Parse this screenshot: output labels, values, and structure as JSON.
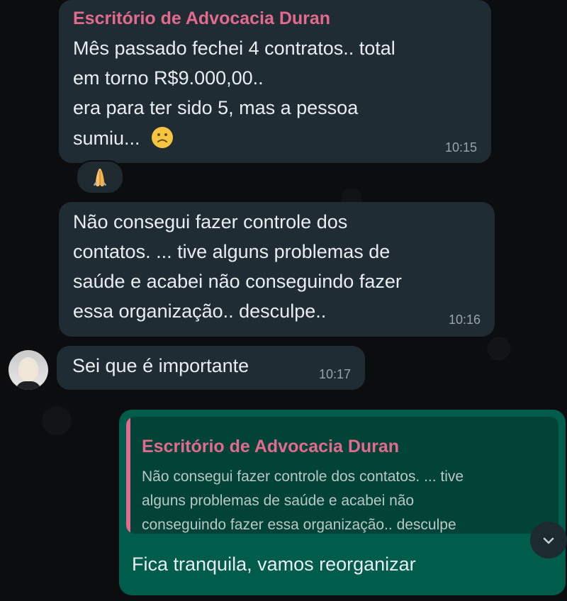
{
  "conversation": {
    "messages": [
      {
        "sender": "Escritório de Advocacia Duran",
        "lines": [
          "Mês passado fechei 4 contratos.. total",
          "em torno R$9.000,00..",
          "era para ter sido 5, mas a pessoa",
          "sumiu..."
        ],
        "time": "10:15",
        "reaction": "🙏"
      },
      {
        "lines": [
          "Não consegui fazer controle dos",
          "contatos. ... tive alguns problemas de",
          "saúde e acabei não conseguindo fazer",
          "essa organização.. desculpe.."
        ],
        "time": "10:16"
      },
      {
        "lines": [
          "Sei que é importante"
        ],
        "time": "10:17"
      }
    ],
    "outgoing": {
      "reply": {
        "sender": "Escritório de Advocacia Duran",
        "lines": [
          "Não consegui fazer controle dos contatos. ... tive",
          "alguns problemas de saúde e acabei não",
          "conseguindo fazer essa organização.. desculpe"
        ]
      },
      "text": "Fica tranquila, vamos reorganizar"
    }
  },
  "icons": {
    "sad_emoji": "sad-face-icon",
    "reaction_emoji": "pray-icon",
    "avatar": "avatar",
    "chevron": "chevron-down-icon"
  },
  "colors": {
    "incoming_bubble": "#202c33",
    "outgoing_bubble": "#005c4b",
    "accent": "#e26a8d",
    "time": "#9aa3a8"
  }
}
